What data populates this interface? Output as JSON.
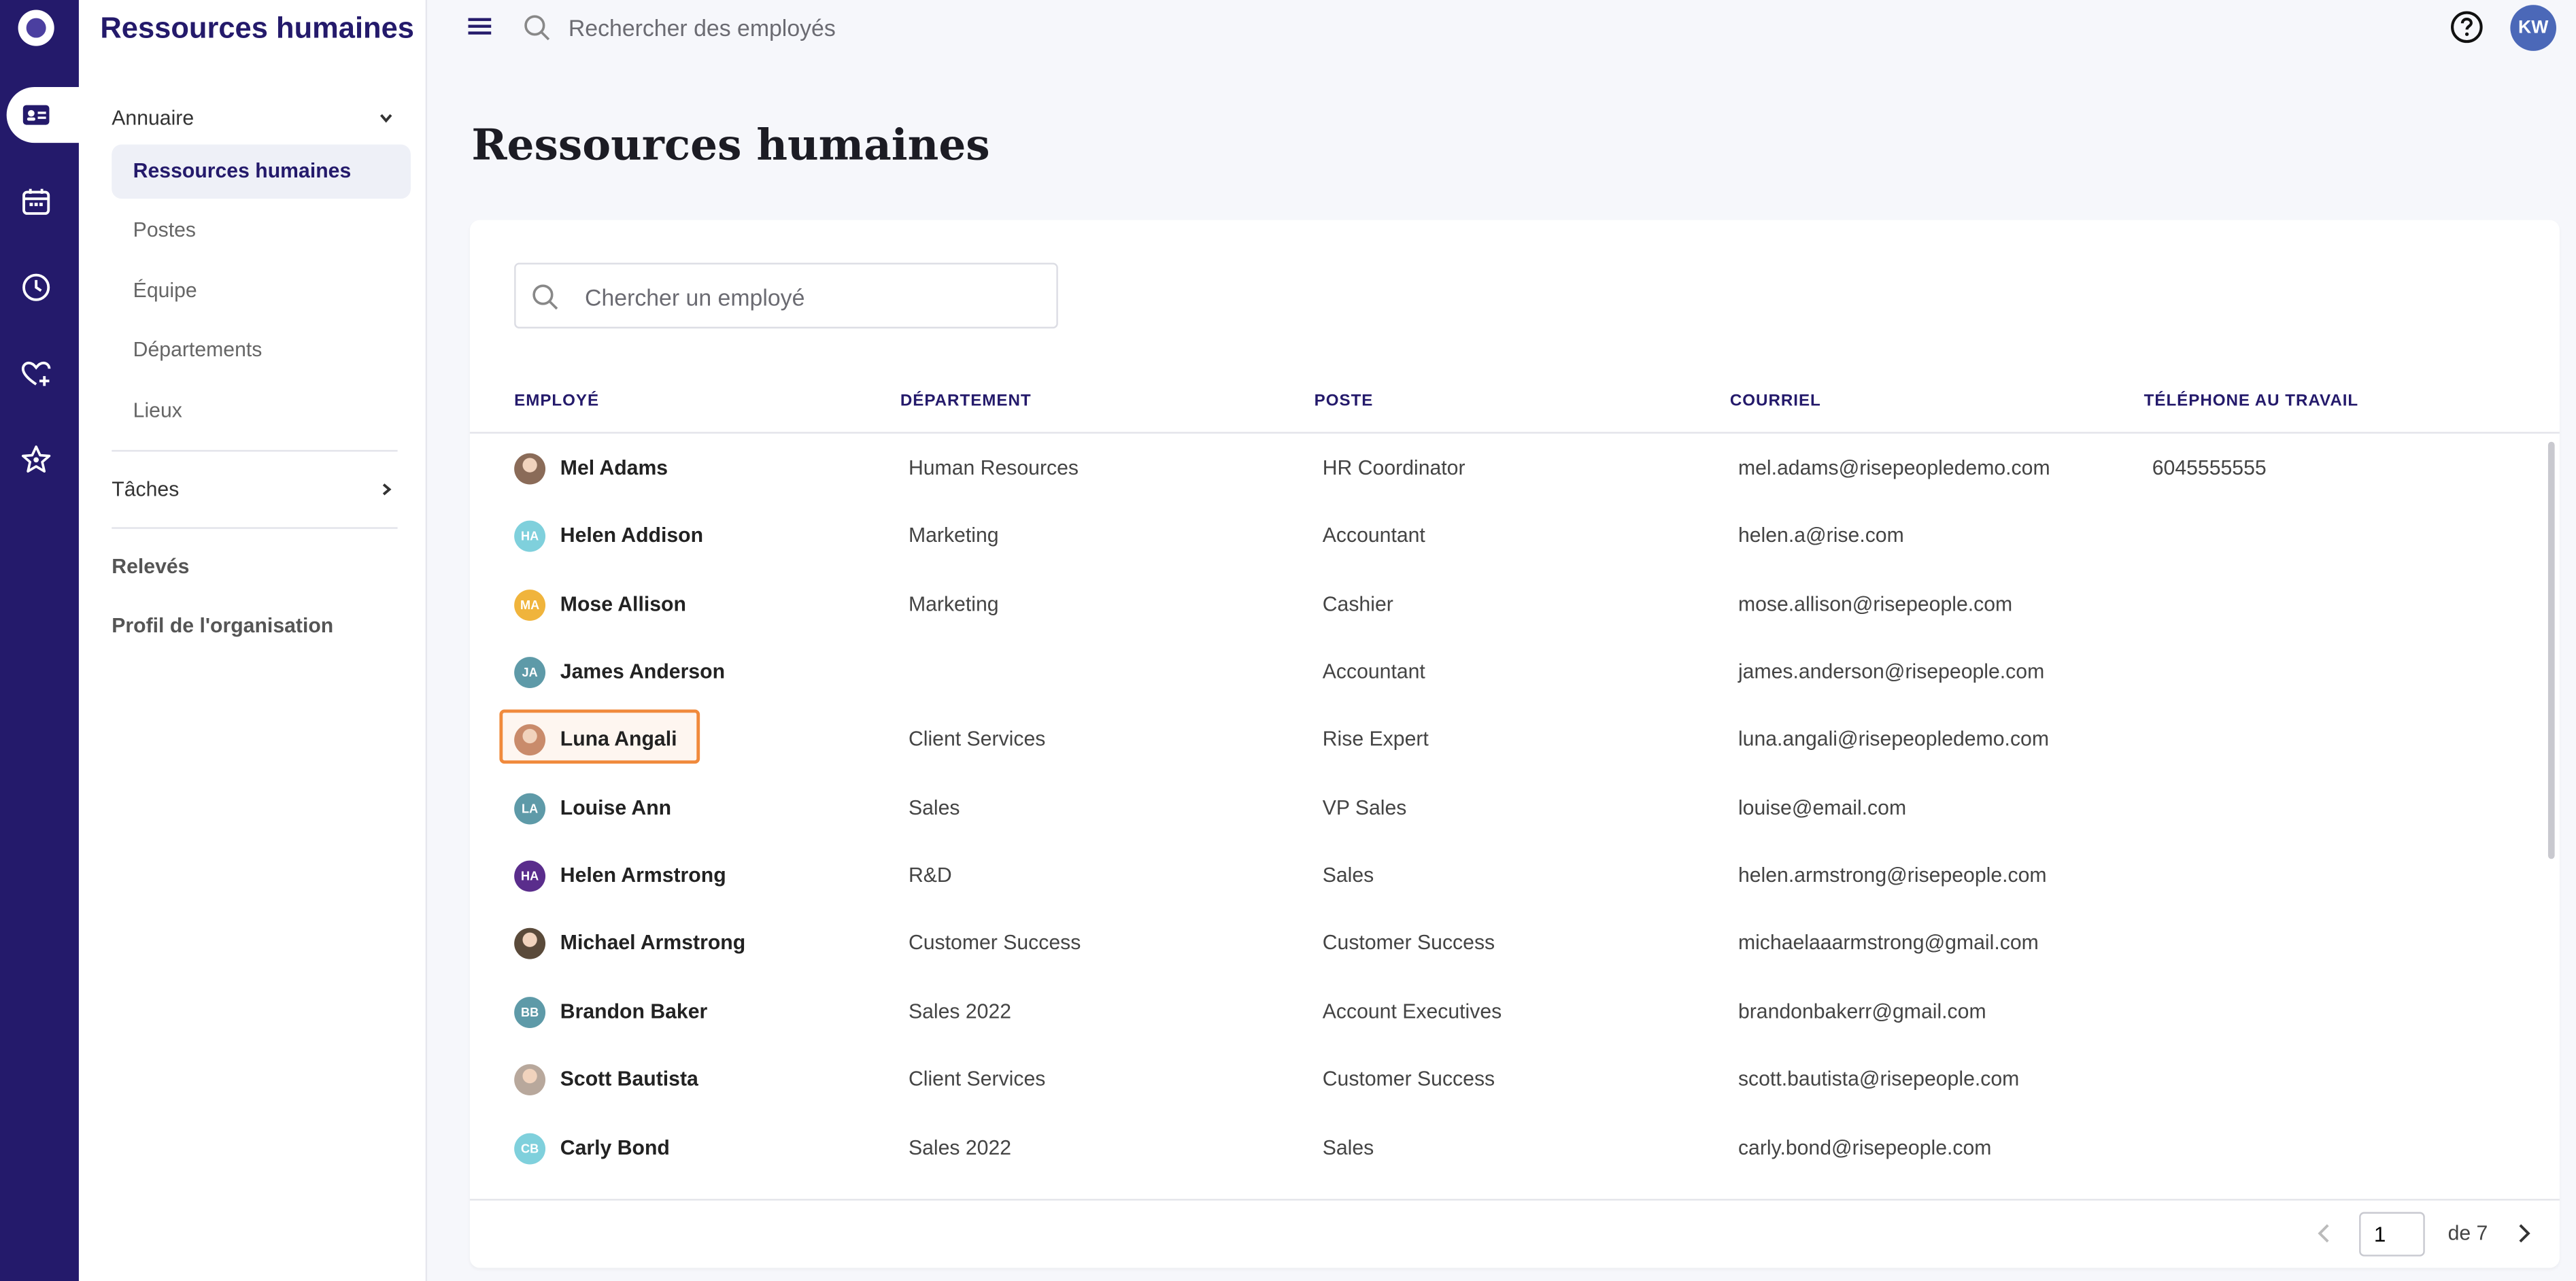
{
  "app": {
    "title": "Ressources humaines"
  },
  "topbar": {
    "search_placeholder": "Rechercher des employés",
    "user_initials": "KW"
  },
  "sidebar": {
    "section_directory": "Annuaire",
    "items": [
      {
        "label": "Ressources humaines",
        "active": true
      },
      {
        "label": "Postes",
        "active": false
      },
      {
        "label": "Équipe",
        "active": false
      },
      {
        "label": "Départements",
        "active": false
      },
      {
        "label": "Lieux",
        "active": false
      }
    ],
    "section_tasks": "Tâches",
    "section_reports": "Relevés",
    "section_org_profile": "Profil de l'organisation"
  },
  "main": {
    "page_title": "Ressources humaines",
    "search_placeholder": "Chercher un employé",
    "columns": [
      "EMPLOYÉ",
      "DÉPARTEMENT",
      "POSTE",
      "COURRIEL",
      "TÉLÉPHONE AU TRAVAIL"
    ],
    "rows": [
      {
        "name": "Mel Adams",
        "department": "Human Resources",
        "position": "HR Coordinator",
        "email": "mel.adams@risepeopledemo.com",
        "phone": "6045555555",
        "avatar": {
          "type": "photo",
          "color": "#8a6b58",
          "initials": ""
        }
      },
      {
        "name": "Helen Addison",
        "department": "Marketing",
        "position": "Accountant",
        "email": "helen.a@rise.com",
        "phone": "",
        "avatar": {
          "type": "initials",
          "color": "#7fd0dc",
          "initials": "HA"
        }
      },
      {
        "name": "Mose Allison",
        "department": "Marketing",
        "position": "Cashier",
        "email": "mose.allison@risepeople.com",
        "phone": "",
        "avatar": {
          "type": "initials",
          "color": "#f0b43c",
          "initials": "MA"
        }
      },
      {
        "name": "James Anderson",
        "department": "",
        "position": "Accountant",
        "email": "james.anderson@risepeople.com",
        "phone": "",
        "avatar": {
          "type": "initials",
          "color": "#5e9aa8",
          "initials": "JA"
        }
      },
      {
        "name": "Luna Angali",
        "department": "Client Services",
        "position": "Rise Expert",
        "email": "luna.angali@risepeopledemo.com",
        "phone": "",
        "avatar": {
          "type": "photo",
          "color": "#c98b6b",
          "initials": ""
        }
      },
      {
        "name": "Louise Ann",
        "department": "Sales",
        "position": "VP Sales",
        "email": "louise@email.com",
        "phone": "",
        "avatar": {
          "type": "initials",
          "color": "#5e9aa8",
          "initials": "LA"
        }
      },
      {
        "name": "Helen Armstrong",
        "department": "R&D",
        "position": "Sales",
        "email": "helen.armstrong@risepeople.com",
        "phone": "",
        "avatar": {
          "type": "initials",
          "color": "#5a2d8c",
          "initials": "HA"
        }
      },
      {
        "name": "Michael Armstrong",
        "department": "Customer Success",
        "position": "Customer Success",
        "email": "michaelaaarmstrong@gmail.com",
        "phone": "",
        "avatar": {
          "type": "photo",
          "color": "#5a4a3a",
          "initials": ""
        }
      },
      {
        "name": "Brandon Baker",
        "department": "Sales 2022",
        "position": "Account Executives",
        "email": "brandonbakerr@gmail.com",
        "phone": "",
        "avatar": {
          "type": "initials",
          "color": "#5e9aa8",
          "initials": "BB"
        }
      },
      {
        "name": "Scott Bautista",
        "department": "Client Services",
        "position": "Customer Success",
        "email": "scott.bautista@risepeople.com",
        "phone": "",
        "avatar": {
          "type": "photo",
          "color": "#b8a89c",
          "initials": ""
        }
      },
      {
        "name": "Carly Bond",
        "department": "Sales 2022",
        "position": "Sales",
        "email": "carly.bond@risepeople.com",
        "phone": "",
        "avatar": {
          "type": "initials",
          "color": "#7fd0dc",
          "initials": "CB"
        }
      }
    ],
    "highlighted_row": 4,
    "pagination": {
      "current_page": "1",
      "of_label": "de 7"
    }
  },
  "colors": {
    "rail": "#241a6b",
    "accent": "#241a6b",
    "highlight": "#f08a3c"
  }
}
